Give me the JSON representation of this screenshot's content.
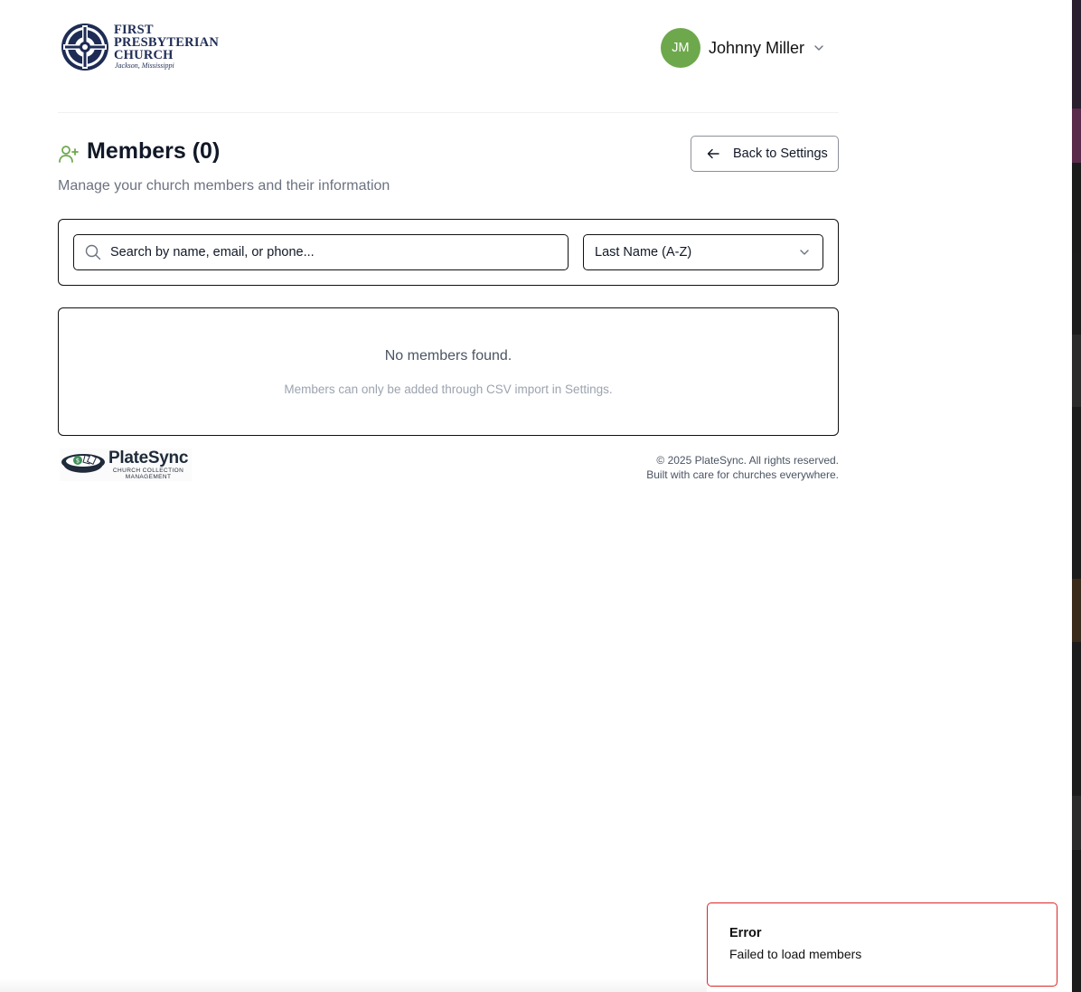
{
  "header": {
    "church_logo": {
      "line1": "FIRST",
      "line2": "PRESBYTERIAN",
      "line3": "CHURCH",
      "line4": "Jackson, Mississippi"
    },
    "user": {
      "initials": "JM",
      "name": "Johnny Miller",
      "avatar_color": "#6ea84c"
    }
  },
  "page": {
    "title": "Members (0)",
    "subtitle": "Manage your church members and their information",
    "back_button_label": "Back to Settings",
    "title_icon": "user-plus-icon",
    "accent_color": "#6ea84c"
  },
  "filters": {
    "search_placeholder": "Search by name, email, or phone...",
    "search_value": "",
    "sort_selected": "Last Name (A-Z)"
  },
  "empty_state": {
    "title": "No members found.",
    "note": "Members can only be added through CSV import in Settings."
  },
  "footer": {
    "logo_name": "PlateSync",
    "logo_tagline_line1": "CHURCH COLLECTION",
    "logo_tagline_line2": "MANAGEMENT",
    "copyright": "© 2025 PlateSync. All rights reserved.",
    "tagline": "Built with care for churches everywhere."
  },
  "toast": {
    "title": "Error",
    "message": "Failed to load members",
    "border_color": "#dc2626"
  }
}
